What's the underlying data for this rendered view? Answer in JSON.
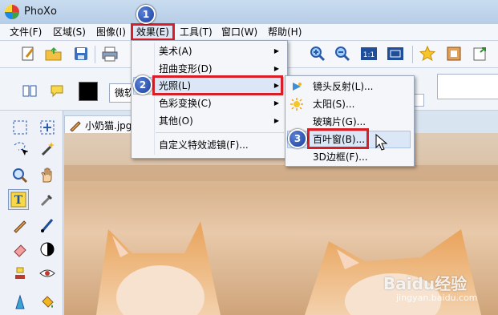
{
  "app": {
    "title": "PhoXo"
  },
  "menubar": {
    "items": [
      "文件(F)",
      "区域(S)",
      "图像(I)",
      "效果(E)",
      "工具(T)",
      "窗口(W)",
      "帮助(H)"
    ]
  },
  "toolbar": {
    "font_value": "微软"
  },
  "document": {
    "tab_label": "小奶猫.jpg"
  },
  "effects_menu": {
    "items": [
      {
        "label": "美术(A)",
        "submenu": true
      },
      {
        "label": "扭曲变形(D)",
        "submenu": true
      },
      {
        "label": "光照(L)",
        "submenu": true
      },
      {
        "label": "色彩变换(C)",
        "submenu": true
      },
      {
        "label": "其他(O)",
        "submenu": true
      },
      {
        "label": "自定义特效滤镜(F)...",
        "submenu": false
      }
    ]
  },
  "lighting_menu": {
    "items": [
      {
        "label": "镜头反射(L)...",
        "icon": "lens-flare-icon"
      },
      {
        "label": "太阳(S)...",
        "icon": "sun-icon"
      },
      {
        "label": "玻璃片(G)...",
        "icon": ""
      },
      {
        "label": "百叶窗(B)...",
        "icon": ""
      },
      {
        "label": "3D边框(F)...",
        "icon": ""
      }
    ]
  },
  "steps": [
    "1",
    "2",
    "3"
  ],
  "watermark": {
    "main": "Baidu经验",
    "sub": "jingyan.baidu.com"
  },
  "colors": {
    "highlight": "#d61f26",
    "badge": "#1a3f9e",
    "menu_bg": "#f4f6f9"
  }
}
